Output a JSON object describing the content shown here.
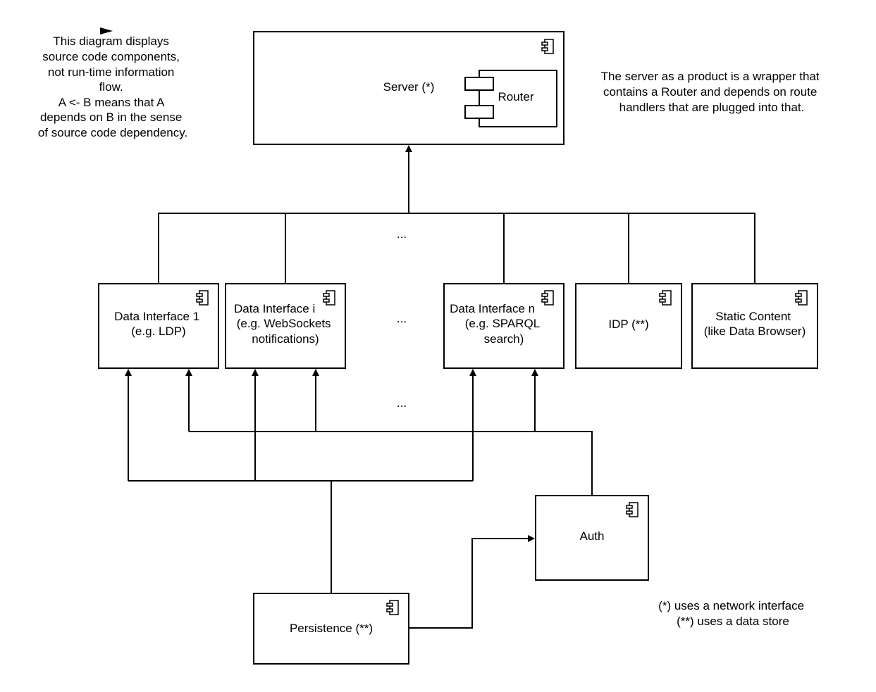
{
  "notes": {
    "legend_left": [
      "This diagram displays",
      "source code components,",
      "not run-time information",
      "flow.",
      "A <- B means that A",
      "depends on B in the sense",
      "of source code dependency."
    ],
    "server_note": [
      "The server as a product is a wrapper that",
      "contains a Router and depends on route",
      "handlers that are plugged into that."
    ],
    "footnotes": [
      "(*) uses a network interface",
      "(**) uses a data store"
    ]
  },
  "components": {
    "server": {
      "label": "Server (*)"
    },
    "router": {
      "label": "Router"
    },
    "data_interface_1": {
      "lines": [
        "Data Interface 1",
        "(e.g. LDP)"
      ]
    },
    "data_interface_i": {
      "lines": [
        "Data Interface i",
        "(e.g. WebSockets",
        "notifications)"
      ]
    },
    "data_interface_n": {
      "lines": [
        "Data Interface n",
        "(e.g. SPARQL",
        "search)"
      ]
    },
    "idp": {
      "label": "IDP (**)"
    },
    "static_content": {
      "lines": [
        "Static Content",
        "(like Data Browser)"
      ]
    },
    "auth": {
      "label": "Auth"
    },
    "persistence": {
      "label": "Persistence (**)"
    }
  },
  "ellipsis": "...",
  "icons": {
    "component": "uml-component-icon"
  }
}
